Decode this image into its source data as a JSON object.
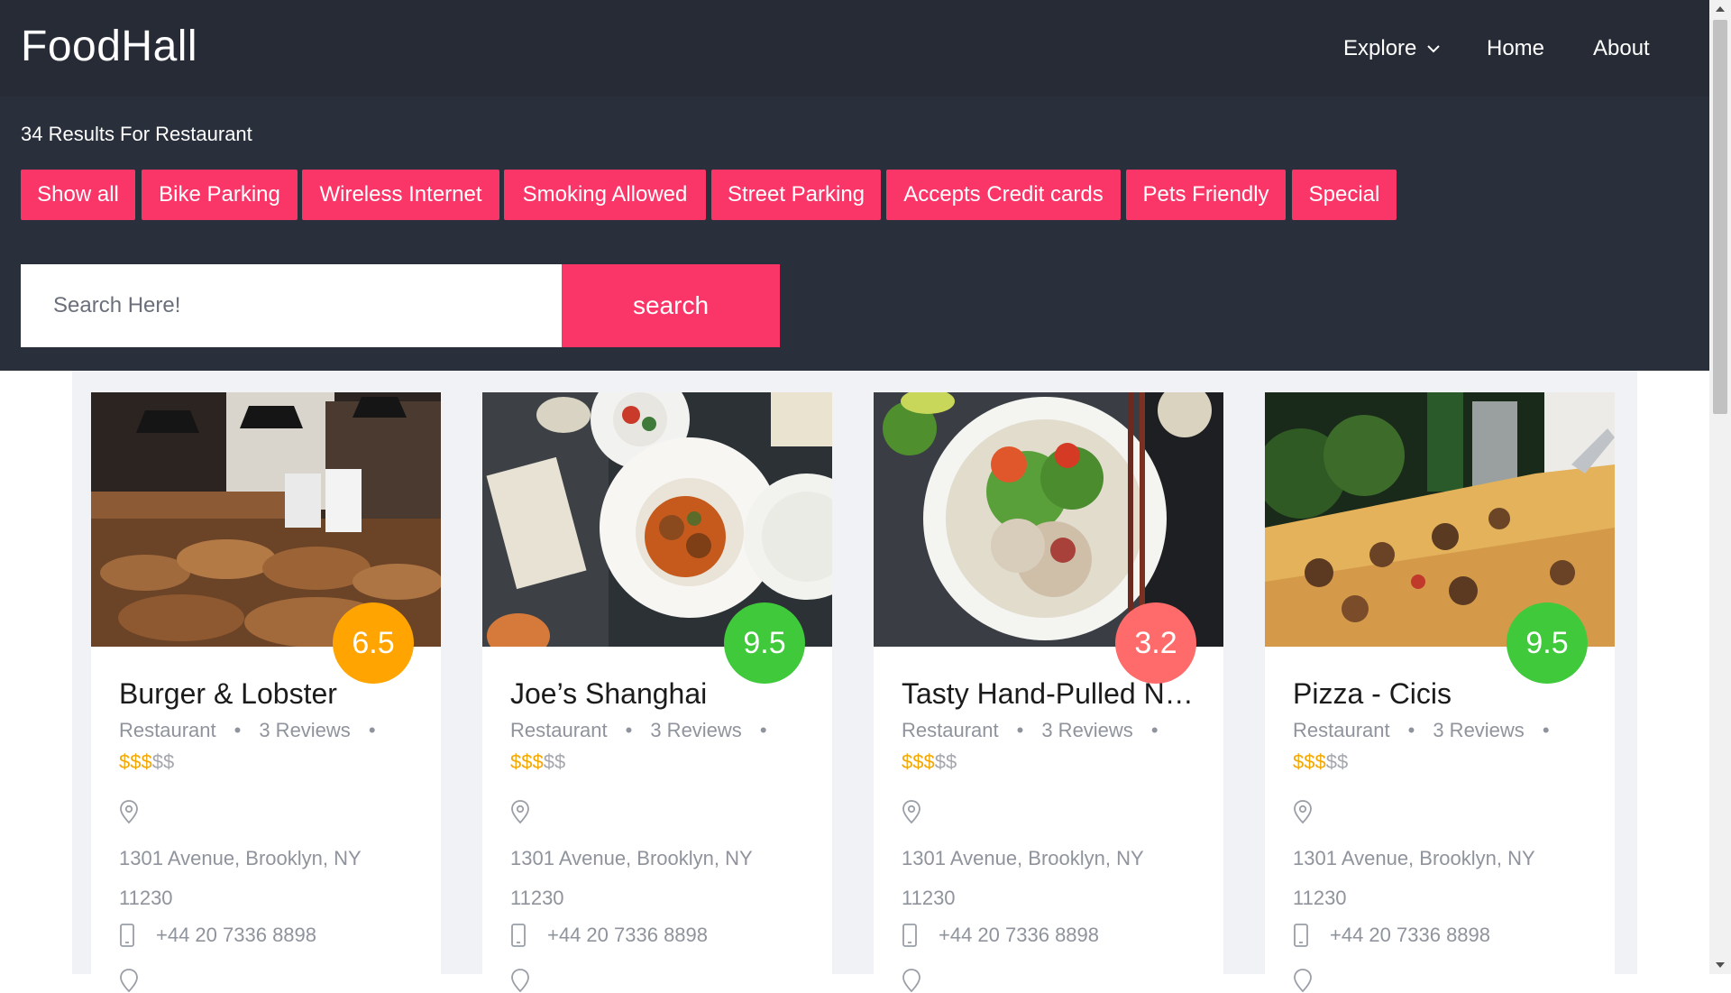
{
  "brand": "FoodHall",
  "nav": {
    "explore": "Explore",
    "home": "Home",
    "about": "About"
  },
  "results_text": "34 Results For Restaurant",
  "filters": [
    "Show all",
    "Bike Parking",
    "Wireless Internet",
    "Smoking Allowed",
    "Street Parking",
    "Accepts Credit cards",
    "Pets Friendly",
    "Special"
  ],
  "search": {
    "placeholder": "Search Here!",
    "button": "search"
  },
  "cards": [
    {
      "title": "Burger & Lobster",
      "category": "Restaurant",
      "reviews": "3 Reviews",
      "price_on": "$$$",
      "price_off": "$$",
      "rating": "6.5",
      "rating_color": "#ffa400",
      "address": "1301 Avenue, Brooklyn, NY 11230",
      "phone": "+44 20 7336 8898",
      "photo": "bakery"
    },
    {
      "title": "Joe’s Shanghai",
      "category": "Restaurant",
      "reviews": "3 Reviews",
      "price_on": "$$$",
      "price_off": "$$",
      "rating": "9.5",
      "rating_color": "#3fc93b",
      "address": "1301 Avenue, Brooklyn, NY 11230",
      "phone": "+44 20 7336 8898",
      "photo": "dishes"
    },
    {
      "title": "Tasty Hand-Pulled Noodles",
      "category": "Restaurant",
      "reviews": "3 Reviews",
      "price_on": "$$$",
      "price_off": "$$",
      "rating": "3.2",
      "rating_color": "#ff6b6b",
      "address": "1301 Avenue, Brooklyn, NY 11230",
      "phone": "+44 20 7336 8898",
      "photo": "noodle-bowl"
    },
    {
      "title": "Pizza - Cicis",
      "category": "Restaurant",
      "reviews": "3 Reviews",
      "price_on": "$$$",
      "price_off": "$$",
      "rating": "9.5",
      "rating_color": "#3fc93b",
      "address": "1301 Avenue, Brooklyn, NY 11230",
      "phone": "+44 20 7336 8898",
      "photo": "pizza"
    }
  ],
  "colors": {
    "accent": "#fa3668",
    "header_bg": "#262b36",
    "filter_bg": "#2a2f3c",
    "price_active": "#f5a700"
  }
}
